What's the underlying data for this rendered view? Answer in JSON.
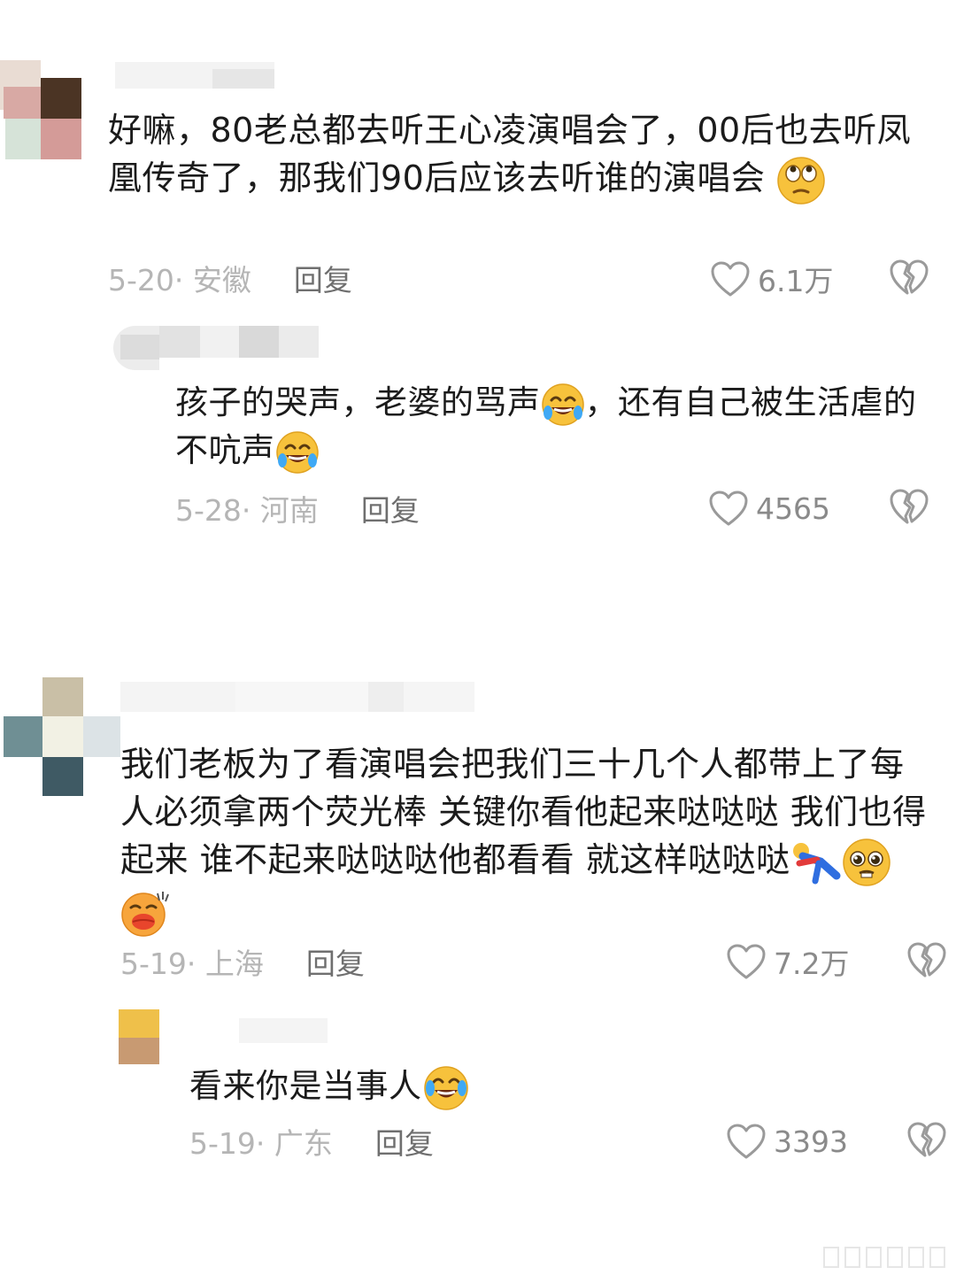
{
  "comments": [
    {
      "text": "好嘛，80老总都去听王心凌演唱会了，00后也去听凤凰传奇了，那我们90后应该去听谁的演唱会",
      "emoji": "eye-roll-emoji",
      "date_location": "5-20· 安徽",
      "reply_label": "回复",
      "like_count": "6.1万",
      "reply": {
        "text_before": "孩子的哭声，老婆的骂声",
        "emoji_mid": "rofl-emoji",
        "text_middle": "，还有自己被生活虐的不吭声",
        "emoji_end": "rofl-emoji",
        "date_location": "5-28· 河南",
        "reply_label": "回复",
        "like_count": "4565"
      }
    },
    {
      "text": "我们老板为了看演唱会把我们三十几个人都带上了每人必须拿两个荧光棒 关键你看他起来哒哒哒 我们也得起来  谁不起来哒哒哒他都看看 就这样哒哒哒",
      "emojis": [
        "dancing-figure-emoji",
        "pleading-emoji",
        "kiss-emoji"
      ],
      "date_location": "5-19· 上海",
      "reply_label": "回复",
      "like_count": "7.2万",
      "reply": {
        "text": "看来你是当事人",
        "emoji": "crying-laughing-emoji",
        "date_location": "5-19· 广东",
        "reply_label": "回复",
        "like_count": "3393"
      }
    }
  ],
  "colors": {
    "text": "#1b1b1b",
    "meta": "#b5b5b5",
    "reply_label": "#6f6f6f",
    "icon": "#9a9a9a",
    "emoji_face": "#f7c23c"
  }
}
